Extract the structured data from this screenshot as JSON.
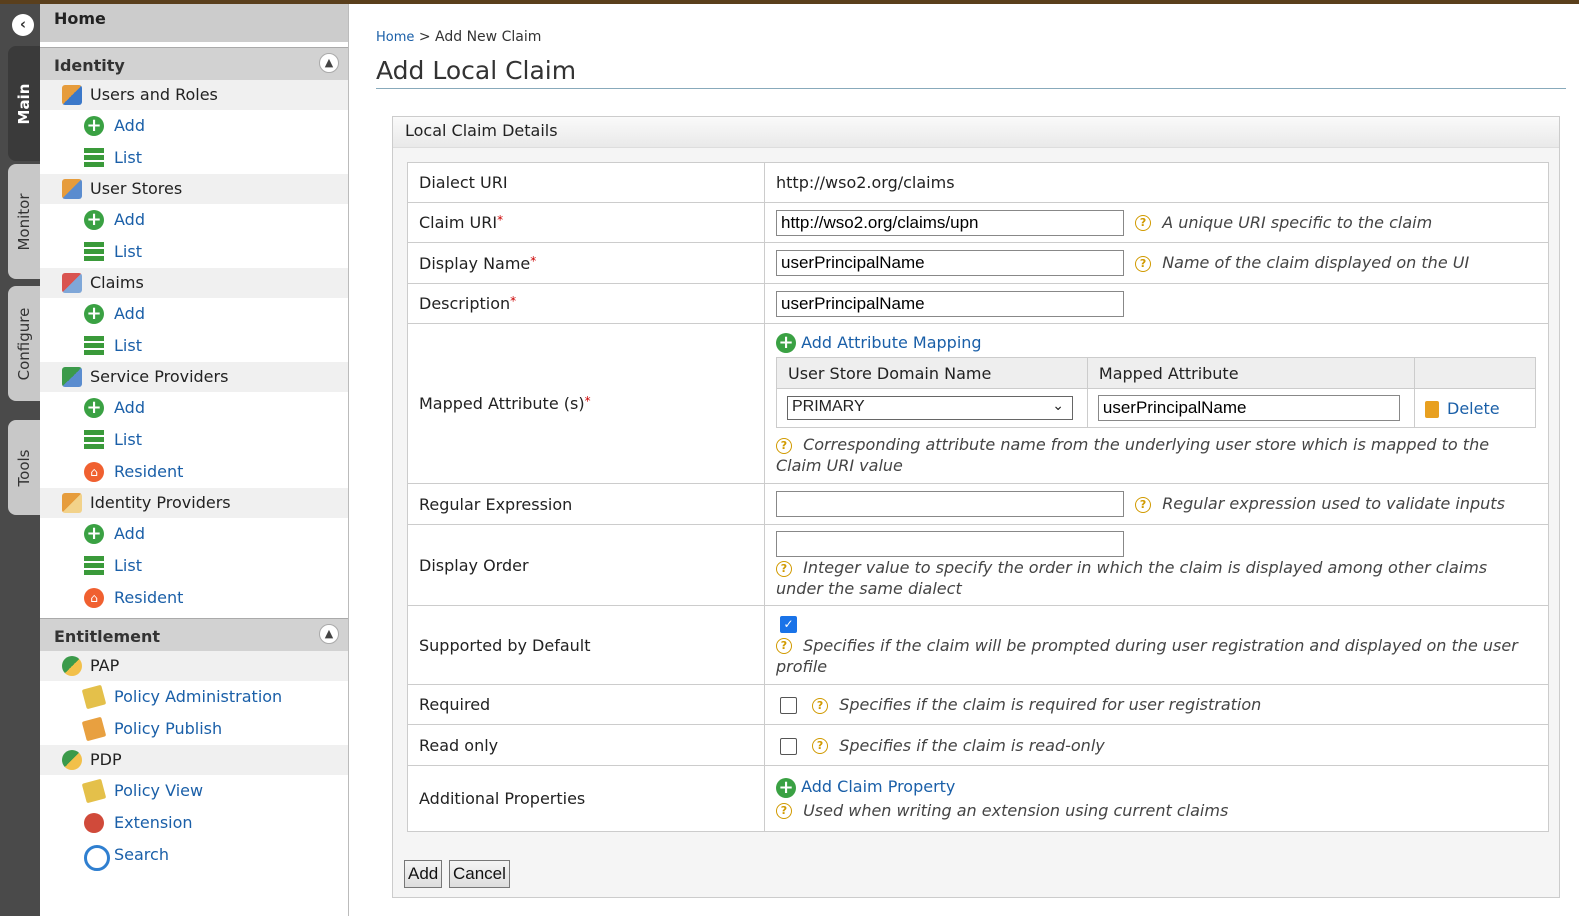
{
  "vtabs": [
    "Main",
    "Monitor",
    "Configure",
    "Tools"
  ],
  "sidebar": {
    "home": "Home",
    "sections": [
      {
        "title": "Identity",
        "groups": [
          {
            "label": "Users and Roles",
            "icon": "users-icon",
            "items": [
              {
                "label": "Add",
                "icon": "add-icon"
              },
              {
                "label": "List",
                "icon": "list-icon"
              }
            ]
          },
          {
            "label": "User Stores",
            "icon": "userstore-icon",
            "items": [
              {
                "label": "Add",
                "icon": "add-icon"
              },
              {
                "label": "List",
                "icon": "list-icon"
              }
            ]
          },
          {
            "label": "Claims",
            "icon": "claims-icon",
            "items": [
              {
                "label": "Add",
                "icon": "add-icon"
              },
              {
                "label": "List",
                "icon": "list-icon"
              }
            ]
          },
          {
            "label": "Service Providers",
            "icon": "service-provider-icon",
            "items": [
              {
                "label": "Add",
                "icon": "add-icon"
              },
              {
                "label": "List",
                "icon": "list-icon"
              },
              {
                "label": "Resident",
                "icon": "resident-icon"
              }
            ]
          },
          {
            "label": "Identity Providers",
            "icon": "identity-provider-icon",
            "items": [
              {
                "label": "Add",
                "icon": "add-icon"
              },
              {
                "label": "List",
                "icon": "list-icon"
              },
              {
                "label": "Resident",
                "icon": "resident-icon"
              }
            ]
          }
        ]
      },
      {
        "title": "Entitlement",
        "groups": [
          {
            "label": "PAP",
            "icon": "pap-icon",
            "items": [
              {
                "label": "Policy Administration",
                "icon": "policy-icon"
              },
              {
                "label": "Policy Publish",
                "icon": "publish-icon"
              }
            ]
          },
          {
            "label": "PDP",
            "icon": "pdp-icon",
            "items": [
              {
                "label": "Policy View",
                "icon": "policy-icon"
              },
              {
                "label": "Extension",
                "icon": "extension-icon"
              },
              {
                "label": "Search",
                "icon": "search-icon"
              }
            ]
          }
        ]
      }
    ]
  },
  "breadcrumb": {
    "home": "Home",
    "sep": ">",
    "current": "Add New Claim"
  },
  "page_title": "Add Local Claim",
  "panel_title": "Local Claim Details",
  "form": {
    "dialect_label": "Dialect URI",
    "dialect_value": "http://wso2.org/claims",
    "claim_uri_label": "Claim URI",
    "claim_uri_value": "http://wso2.org/claims/upn",
    "claim_uri_help": "A unique URI specific to the claim",
    "display_name_label": "Display Name",
    "display_name_value": "userPrincipalName",
    "display_name_help": "Name of the claim displayed on the UI",
    "description_label": "Description",
    "description_value": "userPrincipalName",
    "mapped_label": "Mapped Attribute (s)",
    "add_mapping": "Add Attribute Mapping",
    "col_domain": "User Store Domain Name",
    "col_attr": "Mapped Attribute",
    "domain_value": "PRIMARY",
    "attr_value": "userPrincipalName",
    "delete_label": "Delete",
    "mapped_help": "Corresponding attribute name from the underlying user store which is mapped to the Claim URI value",
    "regex_label": "Regular Expression",
    "regex_value": "",
    "regex_help": "Regular expression used to validate inputs",
    "order_label": "Display Order",
    "order_value": "",
    "order_help": "Integer value to specify the order in which the claim is displayed among other claims under the same dialect",
    "supported_label": "Supported by Default",
    "supported_checked": true,
    "supported_help": "Specifies if the claim will be prompted during user registration and displayed on the user profile",
    "required_label": "Required",
    "required_checked": false,
    "required_help": "Specifies if the claim is required for user registration",
    "readonly_label": "Read only",
    "readonly_checked": false,
    "readonly_help": "Specifies if the claim is read-only",
    "additional_label": "Additional Properties",
    "add_property": "Add Claim Property",
    "additional_help": "Used when writing an extension using current claims"
  },
  "buttons": {
    "add": "Add",
    "cancel": "Cancel"
  },
  "required_mark": "*"
}
